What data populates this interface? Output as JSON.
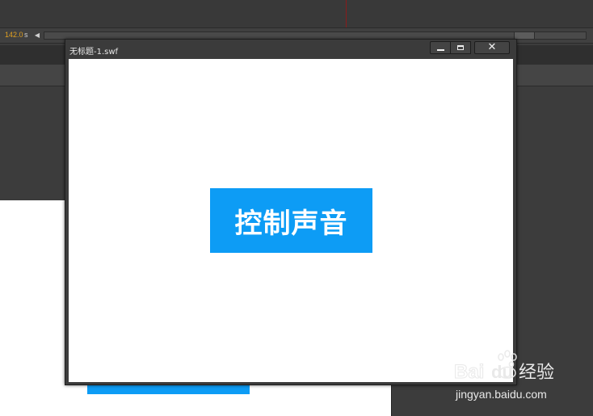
{
  "timeline": {
    "time_value": "142.0",
    "time_unit": "s"
  },
  "swf_window": {
    "title": "无标题-1.swf",
    "minimize_glyph": "minimize-icon",
    "maximize_glyph": "maximize-icon",
    "close_glyph": "✕"
  },
  "content": {
    "button_label": "控制声音",
    "button_color": "#0d9cf5"
  },
  "watermark": {
    "logo_text": "Bai经验",
    "url": "jingyan.baidu.com"
  }
}
